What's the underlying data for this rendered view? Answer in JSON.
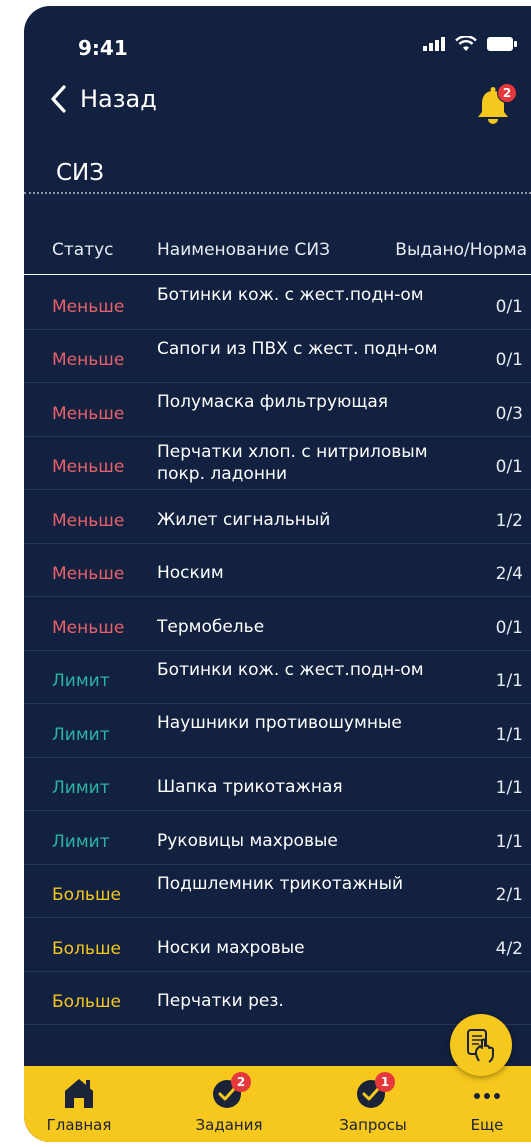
{
  "status_bar": {
    "time": "9:41"
  },
  "header": {
    "back_label": "Назад",
    "notification_count": "2"
  },
  "page": {
    "title": "СИЗ"
  },
  "colors": {
    "background": "#12213f",
    "less": "#e8616a",
    "limit": "#2bb3a3",
    "more": "#f6c71c",
    "accent": "#f6c71c"
  },
  "table": {
    "headers": {
      "status": "Статус",
      "name": "Наименование СИЗ",
      "norm": "Выдано/Норма"
    },
    "rows": [
      {
        "status": "Меньше",
        "kind": "less",
        "name": "Ботинки кож. с жест.подн-ом",
        "qty": "0/1",
        "layout": "high"
      },
      {
        "status": "Меньше",
        "kind": "less",
        "name": "Сапоги из ПВХ с жест. подн-ом",
        "qty": "0/1",
        "layout": "high"
      },
      {
        "status": "Меньше",
        "kind": "less",
        "name": "Полумаска фильтрующая",
        "qty": "0/3",
        "layout": "high"
      },
      {
        "status": "Меньше",
        "kind": "less",
        "name": "Перчатки хлоп. с нитриловым покр. ладонни",
        "qty": "0/1",
        "layout": "two"
      },
      {
        "status": "Меньше",
        "kind": "less",
        "name": "Жилет сигнальный",
        "qty": "1/2",
        "layout": "single"
      },
      {
        "status": "Меньше",
        "kind": "less",
        "name": "Носким",
        "qty": "2/4",
        "layout": "single"
      },
      {
        "status": "Меньше",
        "kind": "less",
        "name": "Термобелье",
        "qty": "0/1",
        "layout": "single"
      },
      {
        "status": "Лимит",
        "kind": "limit",
        "name": "Ботинки кож. с жест.подн-ом",
        "qty": "1/1",
        "layout": "high"
      },
      {
        "status": "Лимит",
        "kind": "limit",
        "name": "Наушники противошумные",
        "qty": "1/1",
        "layout": "high"
      },
      {
        "status": "Лимит",
        "kind": "limit",
        "name": "Шапка трикотажная",
        "qty": "1/1",
        "layout": "single"
      },
      {
        "status": "Лимит",
        "kind": "limit",
        "name": "Руковицы махровые",
        "qty": "1/1",
        "layout": "single"
      },
      {
        "status": "Больше",
        "kind": "more",
        "name": "Подшлемник трикотажный",
        "qty": "2/1",
        "layout": "high"
      },
      {
        "status": "Больше",
        "kind": "more",
        "name": "Носки махровые",
        "qty": "4/2",
        "layout": "single"
      },
      {
        "status": "Больше",
        "kind": "more",
        "name": "Перчатки рез.",
        "qty": "",
        "layout": "single"
      }
    ]
  },
  "bottom_nav": {
    "items": [
      {
        "label": "Главная",
        "icon": "home-icon",
        "badge": ""
      },
      {
        "label": "Задания",
        "icon": "tasks-check-icon",
        "badge": "2"
      },
      {
        "label": "Запросы",
        "icon": "requests-check-icon",
        "badge": "1"
      },
      {
        "label": "Еще",
        "icon": "more-dots-icon",
        "badge": ""
      }
    ]
  }
}
